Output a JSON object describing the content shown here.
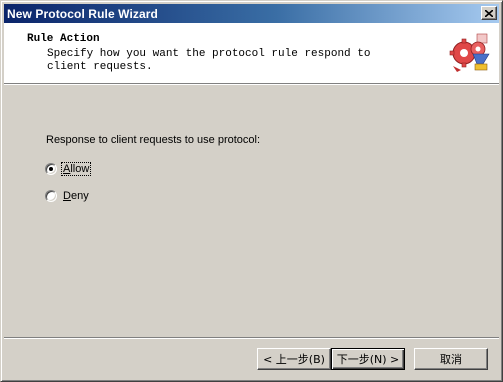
{
  "window": {
    "title": "New Protocol Rule Wizard"
  },
  "header": {
    "title": "Rule Action",
    "description": "Specify how you want the protocol rule respond to client requests.",
    "icon": "wizard-gears-icon"
  },
  "main": {
    "prompt": "Response to client requests to use protocol:",
    "options": [
      {
        "label": "Allow",
        "mnemonic": "A",
        "selected": true
      },
      {
        "label": "Deny",
        "mnemonic": "D",
        "selected": false
      }
    ]
  },
  "footer": {
    "back_label": "< 上一步(B)",
    "next_label": "下一步(N) >",
    "cancel_label": "取消"
  },
  "colors": {
    "titlebar_start": "#0a246a",
    "titlebar_end": "#a6caf0",
    "face": "#d4d0c8"
  }
}
